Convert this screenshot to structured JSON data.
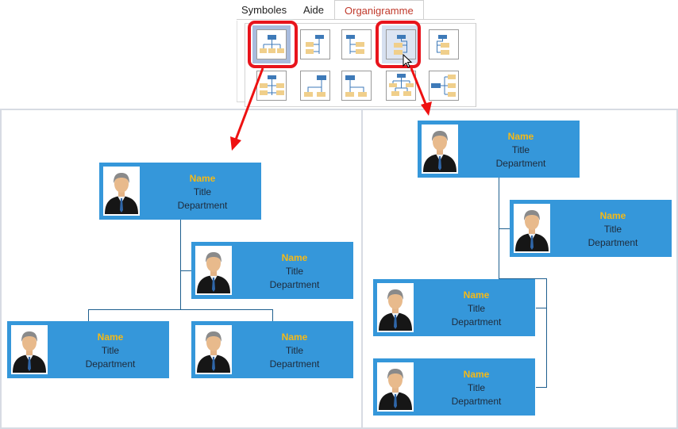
{
  "ribbon": {
    "tabs": [
      {
        "label": "Symboles",
        "active": false
      },
      {
        "label": "Aide",
        "active": false
      },
      {
        "label": "Organigramme",
        "active": true
      }
    ],
    "active_tab_color": "#c0392b",
    "layouts": [
      {
        "name": "top-down-tree",
        "row": 1,
        "selected": true
      },
      {
        "name": "left-hanging-tree",
        "row": 1,
        "selected": false
      },
      {
        "name": "right-hanging-tree",
        "row": 1,
        "selected": false
      },
      {
        "name": "left-hanging-stacked",
        "row": 1,
        "selected": false,
        "hovered": true
      },
      {
        "name": "right-hanging-stacked",
        "row": 1,
        "selected": false
      },
      {
        "name": "both-sides-hanging",
        "row": 2,
        "selected": false
      },
      {
        "name": "top-down-two-children",
        "row": 2,
        "selected": false
      },
      {
        "name": "elbow-two-children",
        "row": 2,
        "selected": false
      },
      {
        "name": "multi-level-tree",
        "row": 2,
        "selected": false
      },
      {
        "name": "left-to-right-tree",
        "row": 2,
        "selected": false
      }
    ],
    "highlight_color": "#e8141c"
  },
  "card_colors": {
    "fill": "#3597da",
    "name": "#f5b916",
    "text": "#1e2a3a",
    "connector": "#1f5f8f"
  },
  "left_chart": {
    "nodes": [
      {
        "name": "Name",
        "title": "Title",
        "department": "Department"
      },
      {
        "name": "Name",
        "title": "Title",
        "department": "Department"
      },
      {
        "name": "Name",
        "title": "Title",
        "department": "Department"
      },
      {
        "name": "Name",
        "title": "Title",
        "department": "Department"
      }
    ]
  },
  "right_chart": {
    "nodes": [
      {
        "name": "Name",
        "title": "Title",
        "department": "Department"
      },
      {
        "name": "Name",
        "title": "Title",
        "department": "Department"
      },
      {
        "name": "Name",
        "title": "Title",
        "department": "Department"
      },
      {
        "name": "Name",
        "title": "Title",
        "department": "Department"
      }
    ]
  }
}
